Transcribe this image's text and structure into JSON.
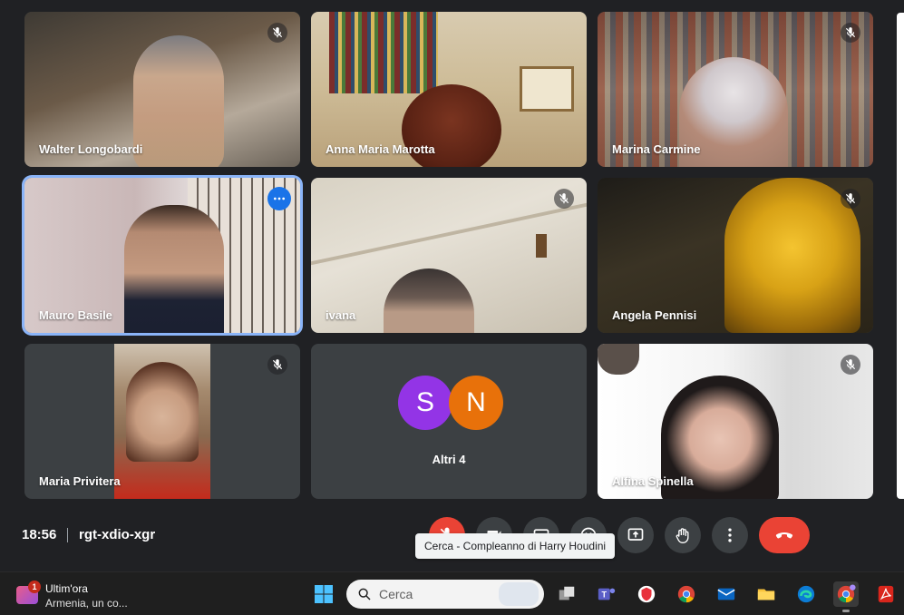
{
  "participants": [
    {
      "name": "Walter Longobardi",
      "muted": true
    },
    {
      "name": "Anna Maria Marotta",
      "muted": false
    },
    {
      "name": "Marina Carmine",
      "muted": true
    },
    {
      "name": "Mauro Basile",
      "muted": false,
      "active": true
    },
    {
      "name": "ivana",
      "muted": true
    },
    {
      "name": "Angela Pennisi",
      "muted": true
    },
    {
      "name": "Maria Privitera",
      "muted": true
    },
    {
      "name": "Altri 4",
      "avatars": [
        {
          "letter": "S",
          "color": "#9334e6"
        },
        {
          "letter": "N",
          "color": "#e8710a"
        }
      ]
    },
    {
      "name": "Alfina Spinella",
      "muted": true
    }
  ],
  "meeting": {
    "time": "18:56",
    "code": "rgt-xdio-xgr"
  },
  "controls": {
    "tooltip": "Cerca - Compleanno di Harry Houdini",
    "icons": [
      "mic-off-icon",
      "camera-icon",
      "captions-icon",
      "emoji-icon",
      "present-icon",
      "hand-icon",
      "more-icon",
      "end-call-icon"
    ]
  },
  "taskbar": {
    "news_badge": "1",
    "news_title": "Ultim'ora",
    "news_subtitle": "Armenia, un co...",
    "search_placeholder": "Cerca",
    "apps": [
      "windows-start-icon",
      "task-view-icon",
      "teams-icon",
      "vpn-icon",
      "chrome-icon",
      "mail-icon",
      "file-explorer-icon",
      "edge-icon",
      "chrome-profile-icon",
      "acrobat-icon"
    ]
  },
  "colors": {
    "background": "#202124",
    "tile": "#3c4043",
    "accent": "#8ab4f8",
    "end_call": "#ea4335"
  }
}
